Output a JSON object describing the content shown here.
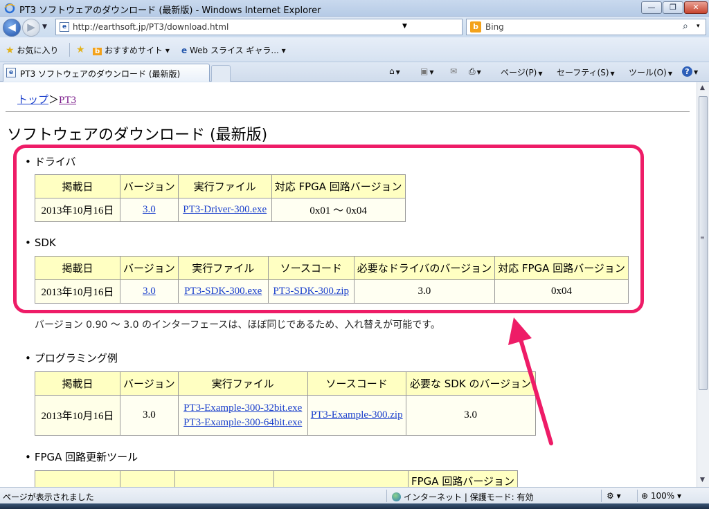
{
  "window": {
    "title": "PT3 ソフトウェアのダウンロード (最新版) - Windows Internet Explorer",
    "min": "—",
    "max": "❐",
    "close": "✕"
  },
  "nav": {
    "back": "◀",
    "forward": "▶",
    "url": "http://earthsoft.jp/PT3/download.html",
    "search_placeholder": "Bing"
  },
  "favorites": {
    "favorites_label": "お気に入り",
    "suggested_sites": "おすすめサイト ▾",
    "web_slice": "Web スライス ギャラ... ▾"
  },
  "tab": {
    "label": "PT3 ソフトウェアのダウンロード (最新版)"
  },
  "commands": {
    "page": "ページ(P)",
    "safety": "セーフティ(S)",
    "tools": "ツール(O)"
  },
  "page": {
    "breadcrumb_top": "トップ",
    "breadcrumb_sep": "＞",
    "breadcrumb_current": "PT3",
    "heading": "ソフトウェアのダウンロード (最新版)",
    "compat_note": "バージョン 0.90 〜 3.0 のインターフェースは、ほぼ同じであるため、入れ替えが可能です。",
    "driver": {
      "label": "ドライバ",
      "headers": [
        "掲載日",
        "バージョン",
        "実行ファイル",
        "対応 FPGA 回路バージョン"
      ],
      "row": {
        "date": "2013年10月16日",
        "version": "3.0",
        "file": "PT3-Driver-300.exe",
        "fpga": "0x01 〜 0x04"
      }
    },
    "sdk": {
      "label": "SDK",
      "headers": [
        "掲載日",
        "バージョン",
        "実行ファイル",
        "ソースコード",
        "必要なドライバのバージョン",
        "対応 FPGA 回路バージョン"
      ],
      "row": {
        "date": "2013年10月16日",
        "version": "3.0",
        "file": "PT3-SDK-300.exe",
        "source": "PT3-SDK-300.zip",
        "driver_ver": "3.0",
        "fpga": "0x04"
      }
    },
    "sample": {
      "label": "プログラミング例",
      "headers": [
        "掲載日",
        "バージョン",
        "実行ファイル",
        "ソースコード",
        "必要な SDK のバージョン"
      ],
      "row": {
        "date": "2013年10月16日",
        "version": "3.0",
        "file32": "PT3-Example-300-32bit.exe",
        "file64": "PT3-Example-300-64bit.exe",
        "source": "PT3-Example-300.zip",
        "sdk_ver": "3.0"
      }
    },
    "fpga": {
      "label": "FPGA 回路更新ツール",
      "header_partial": "FPGA 回路バージョン"
    }
  },
  "status": {
    "text": "ページが表示されました",
    "zone": "インターネット | 保護モード: 有効",
    "zoom": "100%"
  },
  "colors": {
    "highlight": "#ee1c67",
    "table_header": "#ffffc2",
    "link": "#1a3fcc"
  }
}
